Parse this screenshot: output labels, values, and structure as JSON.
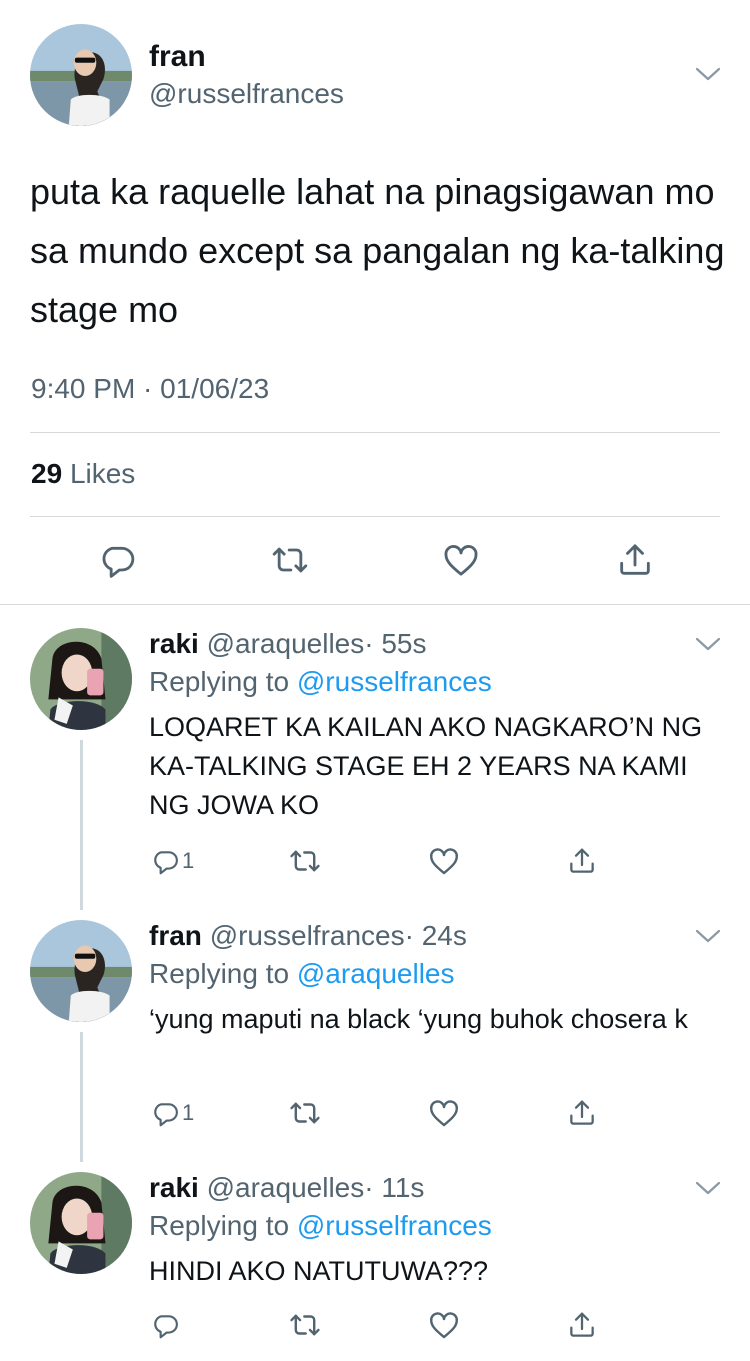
{
  "main_tweet": {
    "name": "fran",
    "handle": "@russelfrances",
    "text": "puta ka raquelle lahat na pinagsigawan mo sa mundo except sa pangalan ng ka-talking stage mo",
    "timestamp": "9:40 PM · 01/06/23",
    "likes_count": "29",
    "likes_label": "Likes"
  },
  "replies": [
    {
      "name": "raki",
      "handle": "@araquelles",
      "time": "· 55s",
      "replying_label": "Replying to",
      "replying_to": "@russelfrances",
      "text": "LOQARET KA KAILAN AKO NAGKARO’N NG KA-TALKING STAGE EH 2 YEARS NA KAMI NG JOWA KO",
      "reply_count": "1"
    },
    {
      "name": "fran",
      "handle": "@russelfrances",
      "time": "· 24s",
      "replying_label": "Replying to",
      "replying_to": "@araquelles",
      "text": "‘yung maputi na black ‘yung buhok chosera k",
      "reply_count": "1"
    },
    {
      "name": "raki",
      "handle": "@araquelles",
      "time": "· 11s",
      "replying_label": "Replying to",
      "replying_to": "@russelfrances",
      "text": "HINDI AKO NATUTUWA???",
      "reply_count": ""
    }
  ],
  "icons": [
    "reply-icon",
    "retweet-icon",
    "like-icon",
    "share-icon",
    "chevron-down-icon"
  ],
  "colors": {
    "text": "#0f1419",
    "secondary": "#536471",
    "link": "#1d9bf0",
    "divider": "#d6d9dc"
  }
}
